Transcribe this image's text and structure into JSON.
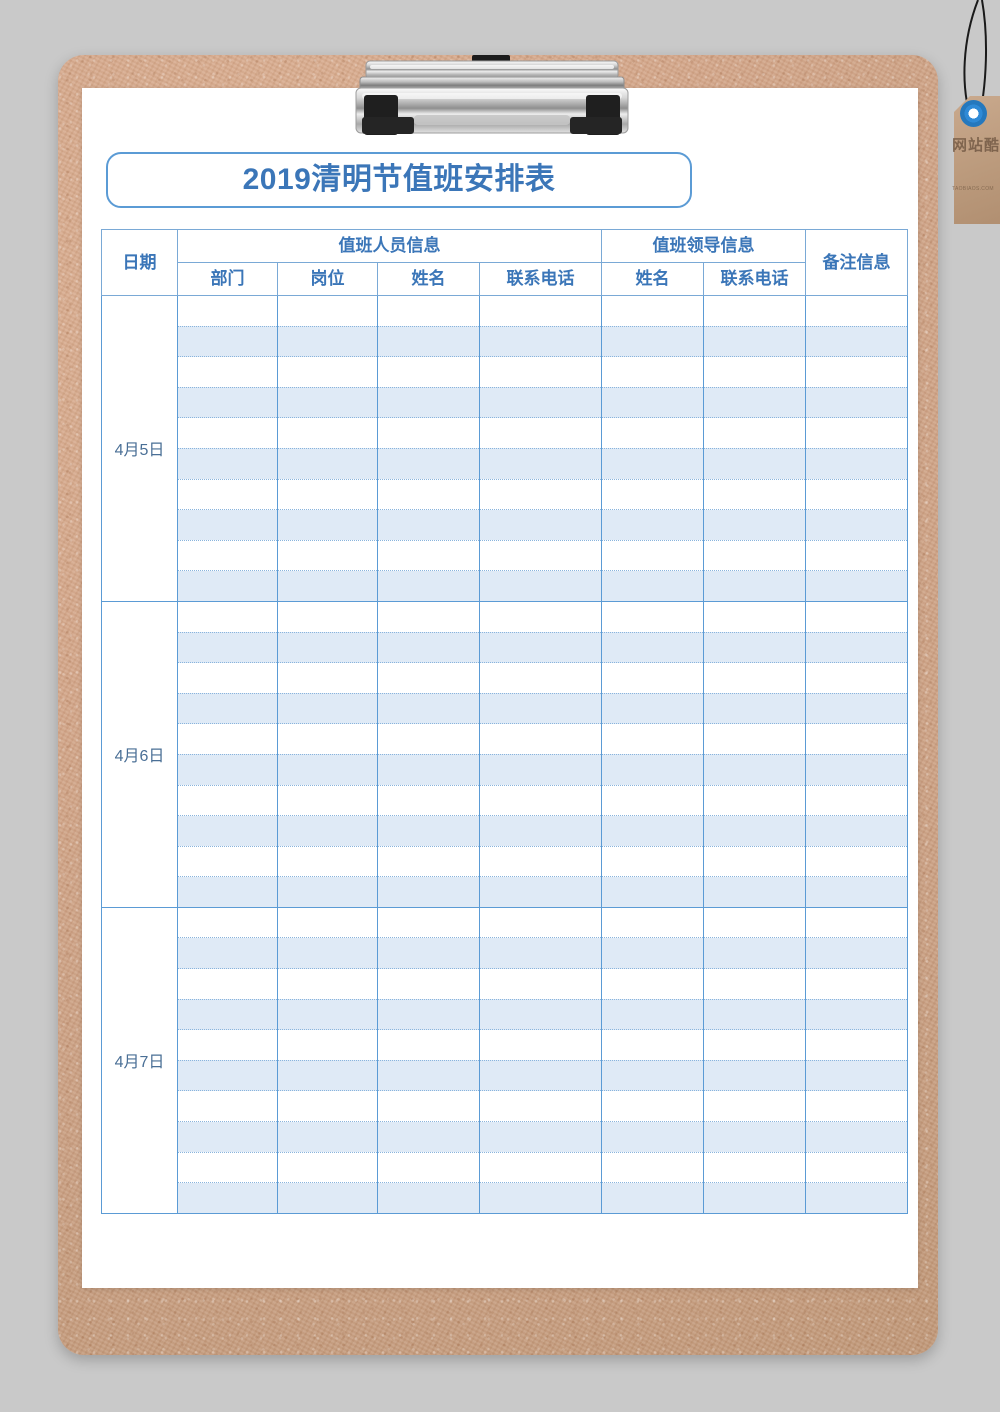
{
  "page": {
    "background_color": "#c9c9c9",
    "board_color": "#d3a689",
    "paper_color": "#ffffff",
    "accent_color": "#5b9bd5",
    "title_text_color": "#3b76b8",
    "header_text_color": "#3b76b8",
    "date_text_color": "#4a6f96",
    "stripe_color": "#dfeaf6"
  },
  "title": {
    "text": "2019清明节值班安排表"
  },
  "hangtag": {
    "logo_text": "网站酷",
    "url_text": "TAOBIAOS.COM"
  },
  "table": {
    "header": {
      "date_label": "日期",
      "group_staff": "值班人员信息",
      "group_leader": "值班领导信息",
      "remark_label": "备注信息",
      "staff_cols": [
        "部门",
        "岗位",
        "姓名",
        "联系电话"
      ],
      "leader_cols": [
        "姓名",
        "联系电话"
      ]
    },
    "rows_per_group": 10,
    "groups": [
      {
        "date": "4月5日",
        "entries": []
      },
      {
        "date": "4月6日",
        "entries": []
      },
      {
        "date": "4月7日",
        "entries": []
      }
    ]
  }
}
